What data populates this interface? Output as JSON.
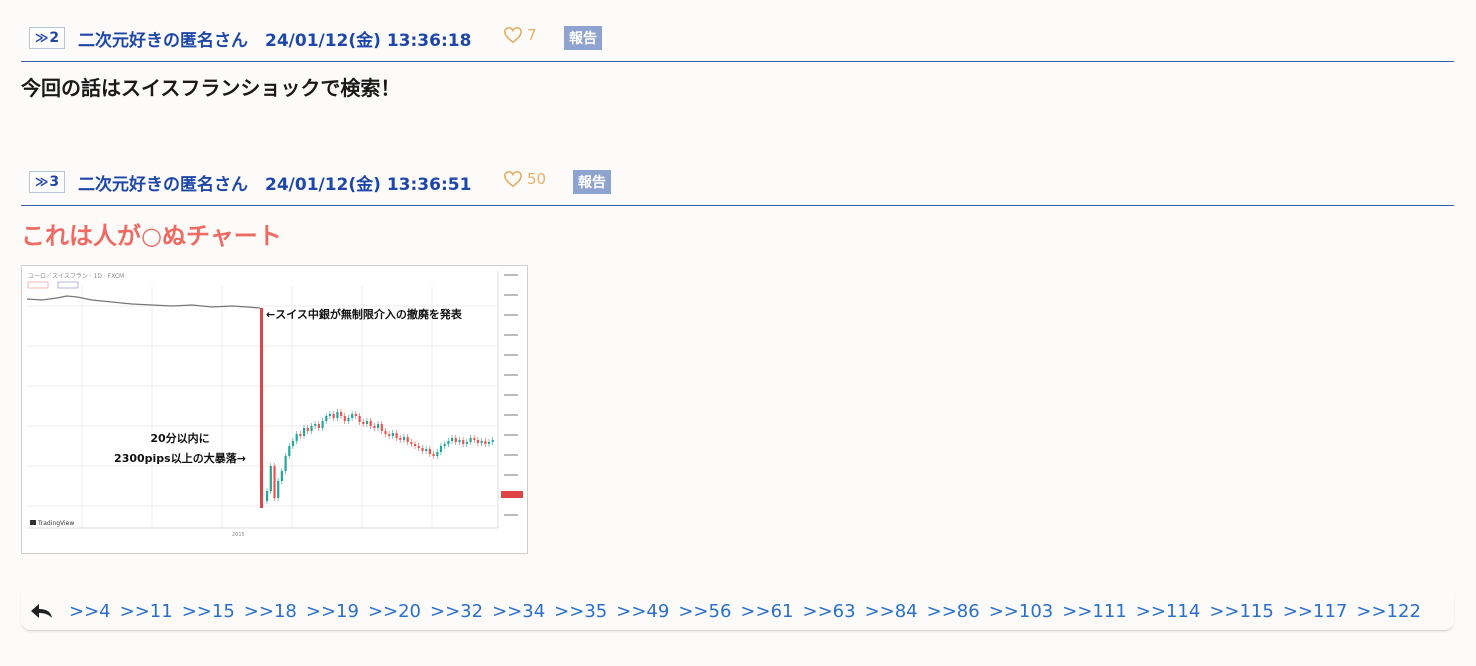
{
  "posts": [
    {
      "number": "2",
      "poster": "二次元好きの匿名さん",
      "timestamp": "24/01/12(金) 13:36:18",
      "likes": "7",
      "report_label": "報告",
      "body": "今回の話はスイスフランショックで検索！"
    },
    {
      "number": "3",
      "poster": "二次元好きの匿名さん",
      "timestamp": "24/01/12(金) 13:36:51",
      "likes": "50",
      "report_label": "報告",
      "body": "これは人が○ぬチャート"
    }
  ],
  "chart_image": {
    "header": "ユーロ／スイスフラン · 1D · FXCM",
    "annotation_top": "←スイス中銀が無制限介入の撤廃を発表",
    "annotation_left_line1": "20分以内に",
    "annotation_left_line2": "2300pips以上の大暴落→",
    "watermark": "TradingView",
    "year_label": "2015"
  },
  "replies": [
    ">>4",
    ">>11",
    ">>15",
    ">>18",
    ">>19",
    ">>20",
    ">>32",
    ">>34",
    ">>35",
    ">>49",
    ">>56",
    ">>61",
    ">>63",
    ">>84",
    ">>86",
    ">>103",
    ">>111",
    ">>114",
    ">>115",
    ">>117",
    ">>122"
  ],
  "colors": {
    "link_blue": "#1f47a8",
    "accent_red": "#ee6b63",
    "like_orange": "#e6b06a",
    "report_bg": "#8ea3cf",
    "reply_link": "#2a6fc9"
  },
  "icons": {
    "like": "heart-icon",
    "reply": "reply-arrow-icon"
  }
}
